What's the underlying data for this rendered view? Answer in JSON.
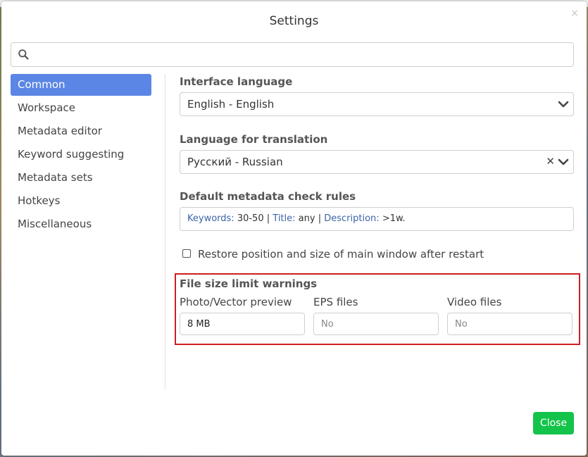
{
  "dialog": {
    "title": "Settings",
    "close_glyph": "×"
  },
  "search": {
    "placeholder": "",
    "value": "",
    "icon": "search-icon"
  },
  "sidebar": {
    "items": [
      {
        "label": "Common",
        "active": true
      },
      {
        "label": "Workspace",
        "active": false
      },
      {
        "label": "Metadata editor",
        "active": false
      },
      {
        "label": "Keyword suggesting",
        "active": false
      },
      {
        "label": "Metadata sets",
        "active": false
      },
      {
        "label": "Hotkeys",
        "active": false
      },
      {
        "label": "Miscellaneous",
        "active": false
      }
    ]
  },
  "interface_language": {
    "label": "Interface language",
    "value": "English - English"
  },
  "translation_language": {
    "label": "Language for translation",
    "value": "Русский - Russian",
    "clear_glyph": "✕"
  },
  "metadata_rules": {
    "label": "Default metadata check rules",
    "keywords_key": "Keywords:",
    "keywords_value": "30-50",
    "sep1": "|",
    "title_key": "Title:",
    "title_value": "any",
    "sep2": "|",
    "description_key": "Description:",
    "description_value": ">1w."
  },
  "restore_window": {
    "label": "Restore position and size of main window after restart",
    "checked": false
  },
  "file_size": {
    "title": "File size limit warnings",
    "photo": {
      "label": "Photo/Vector preview",
      "value": "8 MB",
      "placeholder": ""
    },
    "eps": {
      "label": "EPS files",
      "value": "",
      "placeholder": "No"
    },
    "video": {
      "label": "Video files",
      "value": "",
      "placeholder": "No"
    }
  },
  "footer": {
    "close_label": "Close"
  },
  "colors": {
    "accent": "#5b86e5",
    "close_button": "#13c34a",
    "highlight": "#cc1f1f",
    "rule_key": "#3c64a8"
  }
}
